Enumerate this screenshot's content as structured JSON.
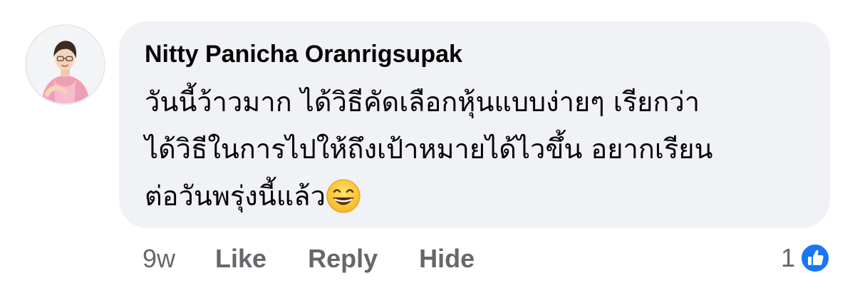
{
  "comment": {
    "author": "Nitty Panicha Oranrigsupak",
    "text_lines": [
      "วันนี้ว้าวมาก ได้วิธีคัดเลือกหุ้นแบบง่ายๆ เรียกว่า",
      "ได้วิธีในการไปให้ถึงเป้าหมายได้ไวขึ้น อยากเรียน",
      "ต่อวันพรุ่งนี้แล้ว"
    ],
    "emoji": "grinning-squinting-face-emoji",
    "timestamp": "9w",
    "actions": {
      "like": "Like",
      "reply": "Reply",
      "hide": "Hide"
    },
    "reaction_count": "1",
    "reaction_icon": "like-thumbs-up-icon"
  },
  "colors": {
    "bubble_bg": "#f0f2f5",
    "text": "#050505",
    "secondary_text": "#65676b",
    "like_blue": "#1877f2"
  }
}
